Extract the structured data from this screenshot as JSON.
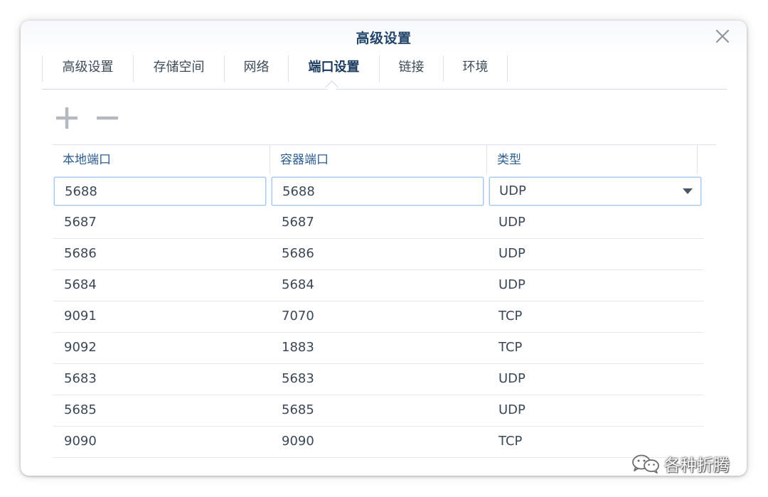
{
  "window": {
    "title": "高级设置"
  },
  "tabs": [
    {
      "label": "高级设置",
      "active": false
    },
    {
      "label": "存储空间",
      "active": false
    },
    {
      "label": "网络",
      "active": false
    },
    {
      "label": "端口设置",
      "active": true
    },
    {
      "label": "链接",
      "active": false
    },
    {
      "label": "环境",
      "active": false
    }
  ],
  "toolbar": {
    "add_icon": "plus-icon",
    "remove_icon": "minus-icon"
  },
  "table": {
    "columns": [
      "本地端口",
      "容器端口",
      "类型"
    ],
    "editing_row": {
      "local_port": "5688",
      "container_port": "5688",
      "type": "UDP"
    },
    "rows": [
      [
        "5687",
        "5687",
        "UDP"
      ],
      [
        "5686",
        "5686",
        "UDP"
      ],
      [
        "5684",
        "5684",
        "UDP"
      ],
      [
        "9091",
        "7070",
        "TCP"
      ],
      [
        "9092",
        "1883",
        "TCP"
      ],
      [
        "5683",
        "5683",
        "UDP"
      ],
      [
        "5685",
        "5685",
        "UDP"
      ],
      [
        "9090",
        "9090",
        "TCP"
      ]
    ]
  },
  "watermark": {
    "text": "各种折腾",
    "icon": "wechat-icon"
  },
  "colors": {
    "title": "#23456a",
    "header_text": "#2d5b8c",
    "focus_border": "#a9c8ea"
  }
}
